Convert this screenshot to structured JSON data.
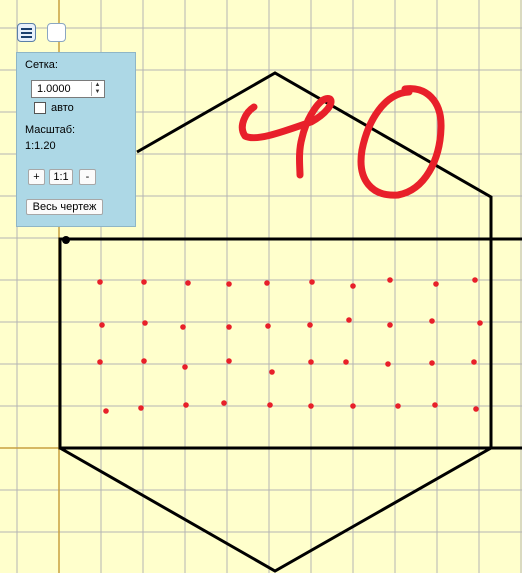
{
  "toolbar": {
    "menu_icon": "hamburger-menu-icon",
    "blank_icon": "blank"
  },
  "panel": {
    "grid_label": "Сетка:",
    "grid_value": "1.0000",
    "auto_label": "авто",
    "auto_checked": false,
    "scale_label": "Масштаб:",
    "scale_value": "1:1.20",
    "zoom_in_label": "+",
    "reset_label": "1:1",
    "zoom_out_label": "-",
    "fit_label": "Весь чертеж"
  },
  "drawing": {
    "handwriting": "40",
    "colors": {
      "background": "#ffffcc",
      "grid": "#b4b4b4",
      "axis": "#c8a040",
      "outline": "#000000",
      "ink": "#e8202a"
    }
  }
}
